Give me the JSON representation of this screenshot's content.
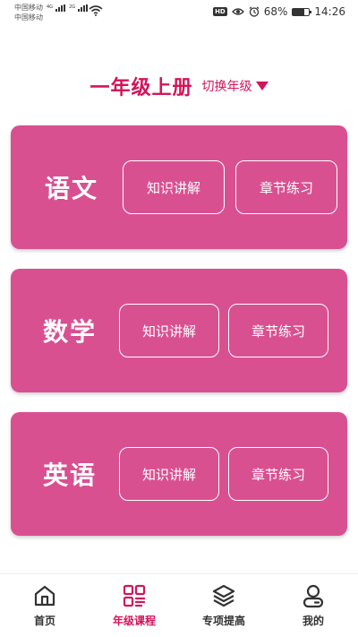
{
  "status_bar": {
    "carrier_1": "中国移动",
    "carrier_1_net": "4G",
    "carrier_2": "中国移动",
    "carrier_2_net": "2G",
    "battery_percent": "68%",
    "battery_level": 0.68,
    "time": "14:26",
    "hd_badge": "HD"
  },
  "header": {
    "title": "一年级上册",
    "switch_label": "切换年级"
  },
  "subjects": [
    {
      "name": "语文",
      "explain_label": "知识讲解",
      "practice_label": "章节练习"
    },
    {
      "name": "数学",
      "explain_label": "知识讲解",
      "practice_label": "章节练习"
    },
    {
      "name": "英语",
      "explain_label": "知识讲解",
      "practice_label": "章节练习"
    }
  ],
  "nav": {
    "items": [
      {
        "label": "首页",
        "icon": "home-icon",
        "active": false
      },
      {
        "label": "年级课程",
        "icon": "grid-icon",
        "active": true
      },
      {
        "label": "专项提高",
        "icon": "layers-icon",
        "active": false
      },
      {
        "label": "我的",
        "icon": "user-icon",
        "active": false
      }
    ]
  },
  "colors": {
    "accent": "#d4145a",
    "card_bg": "#d95091",
    "card_text": "#ffffff",
    "nav_text": "#333333"
  }
}
